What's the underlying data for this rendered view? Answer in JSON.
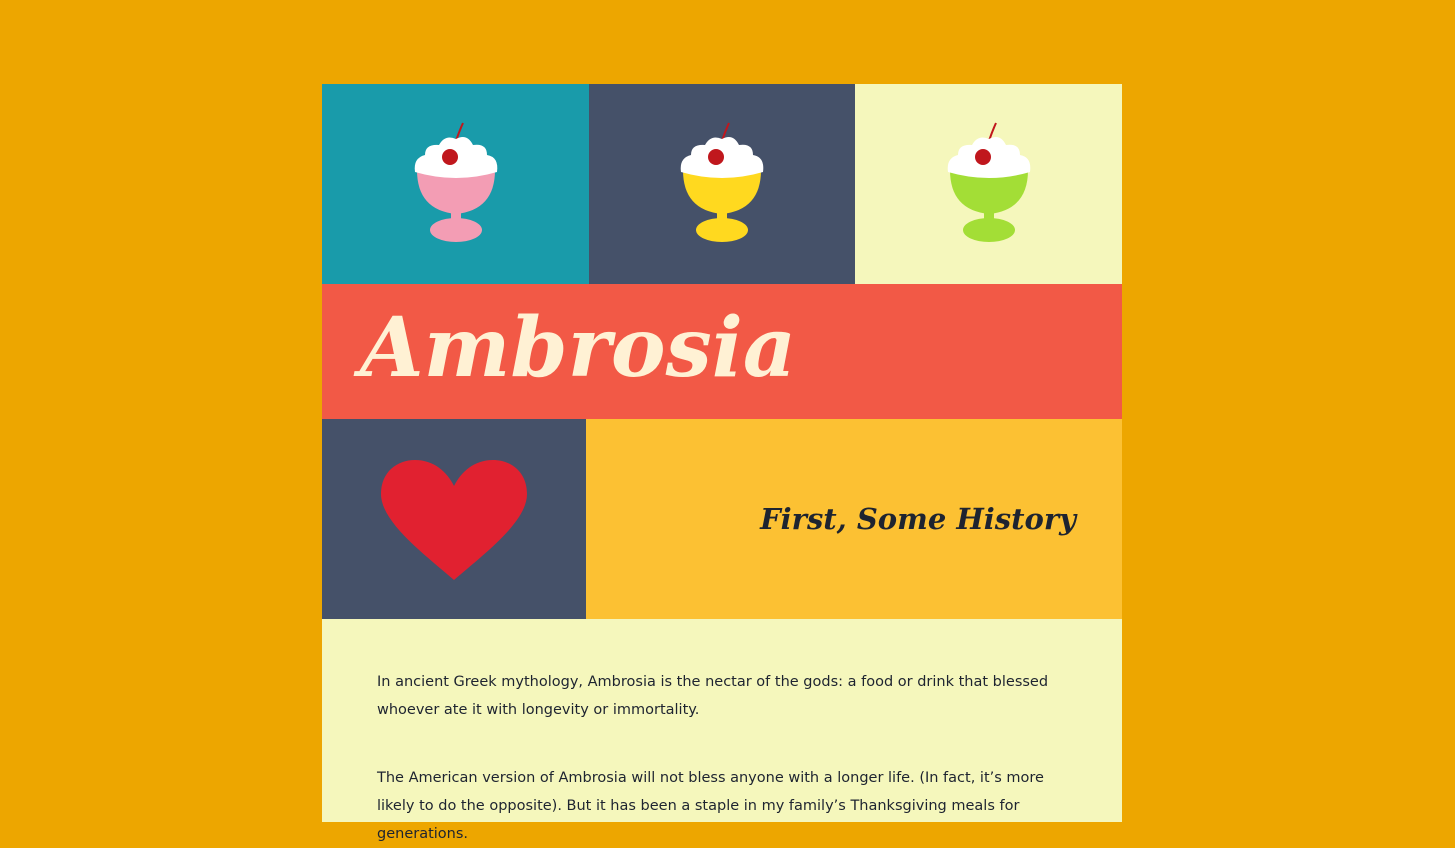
{
  "colors": {
    "background": "#EDA600",
    "title_band": "#F25946",
    "title_text": "#FFF1D4",
    "heart": "#E12130",
    "history_band": "#FCC133",
    "text_area": "#F5F7BC"
  },
  "tiles": [
    {
      "icon": "sundae-icon",
      "tile_color": "#199BAA",
      "cup_color": "#F39DB4"
    },
    {
      "icon": "sundae-icon",
      "tile_color": "#455169",
      "cup_color": "#FFD91F"
    },
    {
      "icon": "sundae-icon",
      "tile_color": "#F5F7BC",
      "cup_color": "#A3DE36"
    }
  ],
  "title": "Ambrosia",
  "heart_icon": "heart-icon",
  "section_heading": "First, Some History",
  "paragraphs": [
    "In ancient Greek mythology, Ambrosia is the nectar of the gods: a food or drink that blessed whoever ate it with longevity or immortality.",
    "The American version of Ambrosia will not bless anyone with a longer life. (In fact, it’s more likely to do the opposite). But it has been a staple in my family’s Thanksgiving meals for generations."
  ]
}
